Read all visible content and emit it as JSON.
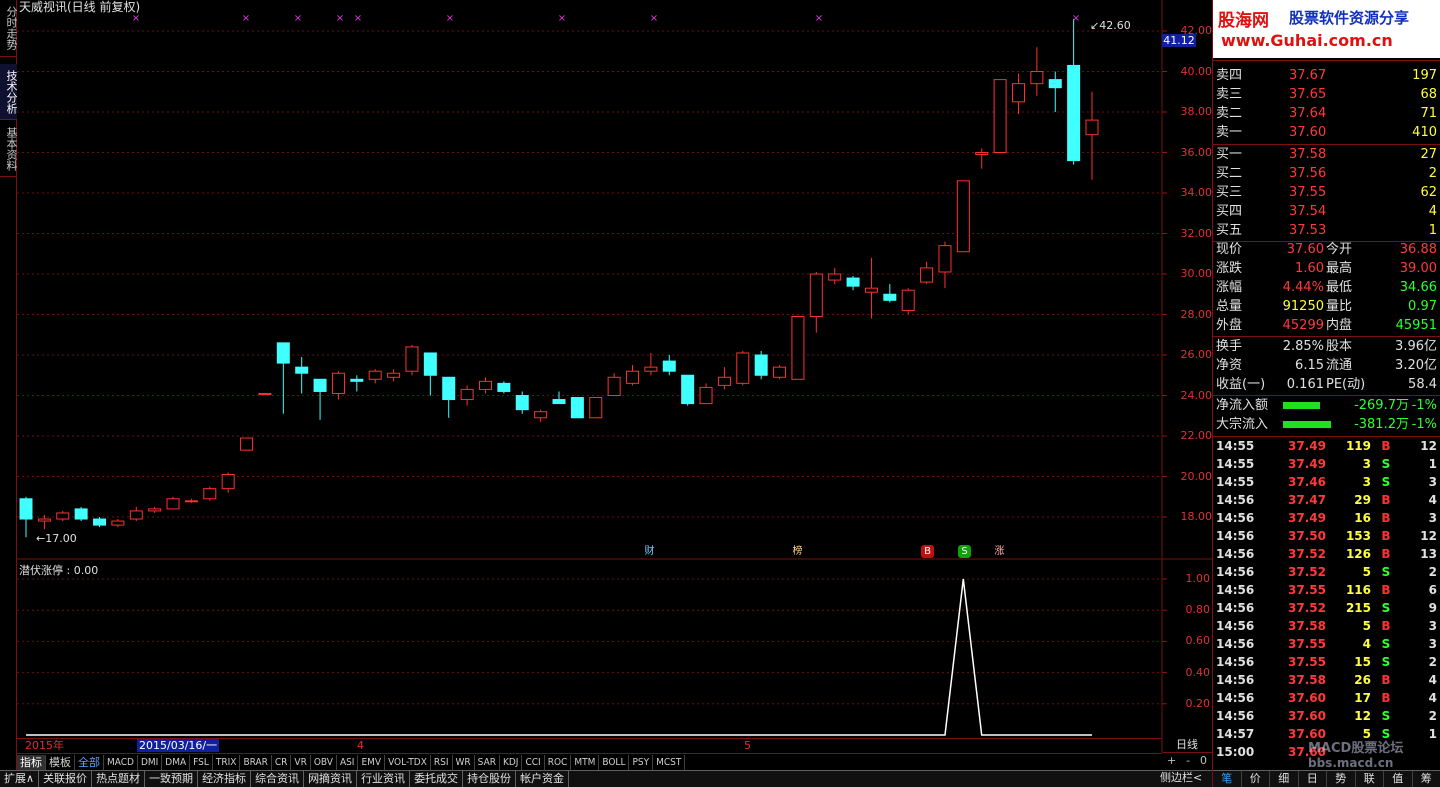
{
  "window": {
    "title": "天威视讯(日线 前复权)"
  },
  "left_tabs": [
    "分时走势",
    "技术分析",
    "基本资料"
  ],
  "chart_data": {
    "type": "candlestick",
    "title": "天威视讯(日线 前复权)",
    "ylim": [
      17,
      42.6
    ],
    "y_ticks": [
      "42.00",
      "40.00",
      "38.00",
      "36.00",
      "34.00",
      "32.00",
      "30.00",
      "28.00",
      "26.00",
      "24.00",
      "22.00",
      "20.00",
      "18.00"
    ],
    "high_label": "42.60",
    "low_label": "17.00",
    "current_price_tag": "41.12",
    "candles": [
      {
        "o": 18.9,
        "h": 19.0,
        "l": 17.0,
        "c": 17.9
      },
      {
        "o": 17.8,
        "h": 18.1,
        "l": 17.4,
        "c": 17.9
      },
      {
        "o": 17.9,
        "h": 18.3,
        "l": 17.8,
        "c": 18.2
      },
      {
        "o": 18.4,
        "h": 18.5,
        "l": 17.8,
        "c": 17.9
      },
      {
        "o": 17.9,
        "h": 18.0,
        "l": 17.5,
        "c": 17.6
      },
      {
        "o": 17.6,
        "h": 17.9,
        "l": 17.5,
        "c": 17.8
      },
      {
        "o": 17.9,
        "h": 18.5,
        "l": 17.8,
        "c": 18.3
      },
      {
        "o": 18.3,
        "h": 18.5,
        "l": 18.2,
        "c": 18.4
      },
      {
        "o": 18.4,
        "h": 19.0,
        "l": 18.4,
        "c": 18.9
      },
      {
        "o": 18.8,
        "h": 18.9,
        "l": 18.7,
        "c": 18.8
      },
      {
        "o": 18.9,
        "h": 19.5,
        "l": 18.8,
        "c": 19.4
      },
      {
        "o": 19.4,
        "h": 20.2,
        "l": 19.2,
        "c": 20.1
      },
      {
        "o": 21.3,
        "h": 21.9,
        "l": 21.3,
        "c": 21.9
      },
      {
        "o": 24.1,
        "h": 24.1,
        "l": 24.1,
        "c": 24.1
      },
      {
        "o": 26.6,
        "h": 26.6,
        "l": 23.1,
        "c": 25.6
      },
      {
        "o": 25.4,
        "h": 25.9,
        "l": 24.1,
        "c": 25.1
      },
      {
        "o": 24.8,
        "h": 24.8,
        "l": 22.8,
        "c": 24.2
      },
      {
        "o": 24.1,
        "h": 25.2,
        "l": 23.8,
        "c": 25.1
      },
      {
        "o": 24.8,
        "h": 25.0,
        "l": 24.2,
        "c": 24.7
      },
      {
        "o": 24.8,
        "h": 25.3,
        "l": 24.6,
        "c": 25.2
      },
      {
        "o": 24.9,
        "h": 25.3,
        "l": 24.7,
        "c": 25.1
      },
      {
        "o": 25.2,
        "h": 26.5,
        "l": 25.0,
        "c": 26.4
      },
      {
        "o": 26.1,
        "h": 26.1,
        "l": 24.0,
        "c": 25.0
      },
      {
        "o": 24.9,
        "h": 24.9,
        "l": 22.9,
        "c": 23.8
      },
      {
        "o": 23.8,
        "h": 24.5,
        "l": 23.5,
        "c": 24.3
      },
      {
        "o": 24.3,
        "h": 24.9,
        "l": 24.1,
        "c": 24.7
      },
      {
        "o": 24.6,
        "h": 24.7,
        "l": 24.1,
        "c": 24.2
      },
      {
        "o": 24.0,
        "h": 24.2,
        "l": 23.1,
        "c": 23.3
      },
      {
        "o": 22.9,
        "h": 23.3,
        "l": 22.7,
        "c": 23.2
      },
      {
        "o": 23.8,
        "h": 24.2,
        "l": 23.6,
        "c": 23.6
      },
      {
        "o": 23.9,
        "h": 23.9,
        "l": 22.9,
        "c": 22.9
      },
      {
        "o": 22.9,
        "h": 23.9,
        "l": 22.9,
        "c": 23.9
      },
      {
        "o": 24.0,
        "h": 25.1,
        "l": 24.0,
        "c": 24.9
      },
      {
        "o": 24.6,
        "h": 25.5,
        "l": 24.5,
        "c": 25.2
      },
      {
        "o": 25.2,
        "h": 26.1,
        "l": 25.0,
        "c": 25.4
      },
      {
        "o": 25.7,
        "h": 26.0,
        "l": 25.0,
        "c": 25.2
      },
      {
        "o": 25.0,
        "h": 25.0,
        "l": 23.5,
        "c": 23.6
      },
      {
        "o": 23.6,
        "h": 24.6,
        "l": 23.6,
        "c": 24.4
      },
      {
        "o": 24.5,
        "h": 25.4,
        "l": 24.3,
        "c": 24.9
      },
      {
        "o": 24.6,
        "h": 26.2,
        "l": 24.5,
        "c": 26.1
      },
      {
        "o": 26.0,
        "h": 26.2,
        "l": 24.8,
        "c": 25.0
      },
      {
        "o": 24.9,
        "h": 25.5,
        "l": 24.8,
        "c": 25.4
      },
      {
        "o": 24.8,
        "h": 27.2,
        "l": 24.8,
        "c": 27.9
      },
      {
        "o": 27.9,
        "h": 30.1,
        "l": 27.1,
        "c": 30.0
      },
      {
        "o": 29.7,
        "h": 30.3,
        "l": 29.5,
        "c": 30.0
      },
      {
        "o": 29.8,
        "h": 29.9,
        "l": 29.2,
        "c": 29.4
      },
      {
        "o": 29.1,
        "h": 30.8,
        "l": 27.8,
        "c": 29.3
      },
      {
        "o": 29.0,
        "h": 29.5,
        "l": 28.6,
        "c": 28.7
      },
      {
        "o": 28.2,
        "h": 29.3,
        "l": 28.0,
        "c": 29.2
      },
      {
        "o": 29.6,
        "h": 30.6,
        "l": 29.5,
        "c": 30.3
      },
      {
        "o": 30.1,
        "h": 31.6,
        "l": 29.3,
        "c": 31.4
      },
      {
        "o": 31.1,
        "h": 34.6,
        "l": 31.1,
        "c": 34.6
      },
      {
        "o": 35.9,
        "h": 36.2,
        "l": 35.2,
        "c": 36.0
      },
      {
        "o": 36.0,
        "h": 39.6,
        "l": 36.0,
        "c": 39.6
      },
      {
        "o": 38.5,
        "h": 39.9,
        "l": 37.9,
        "c": 39.4
      },
      {
        "o": 39.4,
        "h": 41.2,
        "l": 38.8,
        "c": 40.0
      },
      {
        "o": 39.6,
        "h": 40.0,
        "l": 38.0,
        "c": 39.2
      },
      {
        "o": 40.3,
        "h": 42.6,
        "l": 35.4,
        "c": 35.6
      },
      {
        "o": 36.88,
        "h": 39.0,
        "l": 34.66,
        "c": 37.6
      }
    ],
    "top_markers": 9,
    "events": [
      {
        "label": "财",
        "color": "#7fc8ff"
      },
      {
        "label": "榜",
        "color": "#ffd080"
      },
      {
        "label": "B",
        "color": "#ffffff",
        "bg": "#c01010"
      },
      {
        "label": "S",
        "color": "#ffffff",
        "bg": "#10a010"
      },
      {
        "label": "涨",
        "color": "#ffb0b0"
      }
    ],
    "indicator": {
      "name": "潜伏涨停",
      "value": "0.00",
      "y_ticks": [
        "1.00",
        "0.80",
        "0.60",
        "0.40",
        "0.20"
      ],
      "ylim": [
        0,
        1.0
      ],
      "values": [
        0,
        0,
        0,
        0,
        0,
        0,
        0,
        0,
        0,
        0,
        0,
        0,
        0,
        0,
        0,
        0,
        0,
        0,
        0,
        0,
        0,
        0,
        0,
        0,
        0,
        0,
        0,
        0,
        0,
        0,
        0,
        0,
        0,
        0,
        0,
        0,
        0,
        0,
        0,
        0,
        0,
        0,
        0,
        0,
        0,
        0,
        0,
        0,
        0,
        0,
        0,
        1,
        0,
        0,
        0,
        0,
        0,
        0,
        0
      ]
    },
    "x_labels": [
      "2015年",
      "4",
      "5"
    ],
    "date_cursor": "2015/03/16/一"
  },
  "period_label": "日线",
  "zoom_controls": [
    "+",
    "-",
    "0"
  ],
  "indicator_tabs": [
    "指标",
    "模板",
    "全部",
    "MACD",
    "DMI",
    "DMA",
    "FSL",
    "TRIX",
    "BRAR",
    "CR",
    "VR",
    "OBV",
    "ASI",
    "EMV",
    "VOL-TDX",
    "RSI",
    "WR",
    "SAR",
    "KDJ",
    "CCI",
    "ROC",
    "MTM",
    "BOLL",
    "PSY",
    "MCST"
  ],
  "bottom_tabs": [
    "扩展∧",
    "关联报价",
    "热点题材",
    "一致预期",
    "经济指标",
    "综合资讯",
    "网摘资讯",
    "行业资讯",
    "委托成交",
    "持仓股份",
    "帐户资金"
  ],
  "side_toggle": "侧边栏<",
  "ad": {
    "brand": "股海网",
    "tag": "股票软件资源分享",
    "url": "www.Guhai.com.cn"
  },
  "order_book": {
    "asks": [
      {
        "label": "卖四",
        "price": "37.67",
        "vol": "197"
      },
      {
        "label": "卖三",
        "price": "37.65",
        "vol": "68"
      },
      {
        "label": "卖二",
        "price": "37.64",
        "vol": "71"
      },
      {
        "label": "卖一",
        "price": "37.60",
        "vol": "410"
      }
    ],
    "bids": [
      {
        "label": "买一",
        "price": "37.58",
        "vol": "27"
      },
      {
        "label": "买二",
        "price": "37.56",
        "vol": "2"
      },
      {
        "label": "买三",
        "price": "37.55",
        "vol": "62"
      },
      {
        "label": "买四",
        "price": "37.54",
        "vol": "4"
      },
      {
        "label": "买五",
        "price": "37.53",
        "vol": "1"
      }
    ]
  },
  "quote": [
    {
      "k1": "现价",
      "v1": "37.60",
      "c1": "r",
      "k2": "今开",
      "v2": "36.88",
      "c2": "r"
    },
    {
      "k1": "涨跌",
      "v1": "1.60",
      "c1": "r",
      "k2": "最高",
      "v2": "39.00",
      "c2": "r"
    },
    {
      "k1": "涨幅",
      "v1": "4.44%",
      "c1": "r",
      "k2": "最低",
      "v2": "34.66",
      "c2": "g"
    },
    {
      "k1": "总量",
      "v1": "91250",
      "c1": "y",
      "k2": "量比",
      "v2": "0.97",
      "c2": "g"
    },
    {
      "k1": "外盘",
      "v1": "45299",
      "c1": "r",
      "k2": "内盘",
      "v2": "45951",
      "c2": "g"
    }
  ],
  "fund": [
    {
      "k1": "换手",
      "v1": "2.85%",
      "k2": "股本",
      "v2": "3.96亿"
    },
    {
      "k1": "净资",
      "v1": "6.15",
      "k2": "流通",
      "v2": "3.20亿"
    },
    {
      "k1": "收益(一)",
      "v1": "0.161",
      "k2": "PE(动)",
      "v2": "58.4"
    }
  ],
  "flows": [
    {
      "label": "净流入额",
      "value": "-269.7万",
      "pct": "-1%",
      "bar": 0.55
    },
    {
      "label": "大宗流入",
      "value": "-381.2万",
      "pct": "-1%",
      "bar": 0.7
    }
  ],
  "ticks": [
    {
      "t": "14:55",
      "p": "37.49",
      "v": "119",
      "d": "B",
      "n": "12"
    },
    {
      "t": "14:55",
      "p": "37.49",
      "v": "3",
      "d": "S",
      "n": "1"
    },
    {
      "t": "14:55",
      "p": "37.46",
      "v": "3",
      "d": "S",
      "n": "3"
    },
    {
      "t": "14:56",
      "p": "37.47",
      "v": "29",
      "d": "B",
      "n": "4"
    },
    {
      "t": "14:56",
      "p": "37.49",
      "v": "16",
      "d": "B",
      "n": "3"
    },
    {
      "t": "14:56",
      "p": "37.50",
      "v": "153",
      "d": "B",
      "n": "12"
    },
    {
      "t": "14:56",
      "p": "37.52",
      "v": "126",
      "d": "B",
      "n": "13"
    },
    {
      "t": "14:56",
      "p": "37.52",
      "v": "5",
      "d": "S",
      "n": "2"
    },
    {
      "t": "14:56",
      "p": "37.55",
      "v": "116",
      "d": "B",
      "n": "6"
    },
    {
      "t": "14:56",
      "p": "37.52",
      "v": "215",
      "d": "S",
      "n": "9"
    },
    {
      "t": "14:56",
      "p": "37.58",
      "v": "5",
      "d": "B",
      "n": "3"
    },
    {
      "t": "14:56",
      "p": "37.55",
      "v": "4",
      "d": "S",
      "n": "3"
    },
    {
      "t": "14:56",
      "p": "37.55",
      "v": "15",
      "d": "S",
      "n": "2"
    },
    {
      "t": "14:56",
      "p": "37.58",
      "v": "26",
      "d": "B",
      "n": "4"
    },
    {
      "t": "14:56",
      "p": "37.60",
      "v": "17",
      "d": "B",
      "n": "4"
    },
    {
      "t": "14:56",
      "p": "37.60",
      "v": "12",
      "d": "S",
      "n": "2"
    },
    {
      "t": "14:57",
      "p": "37.60",
      "v": "5",
      "d": "S",
      "n": "1"
    },
    {
      "t": "15:00",
      "p": "37.60",
      "v": "",
      "d": "",
      "n": ""
    }
  ],
  "right_tabs": [
    "笔",
    "价",
    "细",
    "日",
    "势",
    "联",
    "值",
    "筹"
  ],
  "watermark": {
    "l1": "MACD股票论坛",
    "l2": "bbs.macd.cn"
  }
}
